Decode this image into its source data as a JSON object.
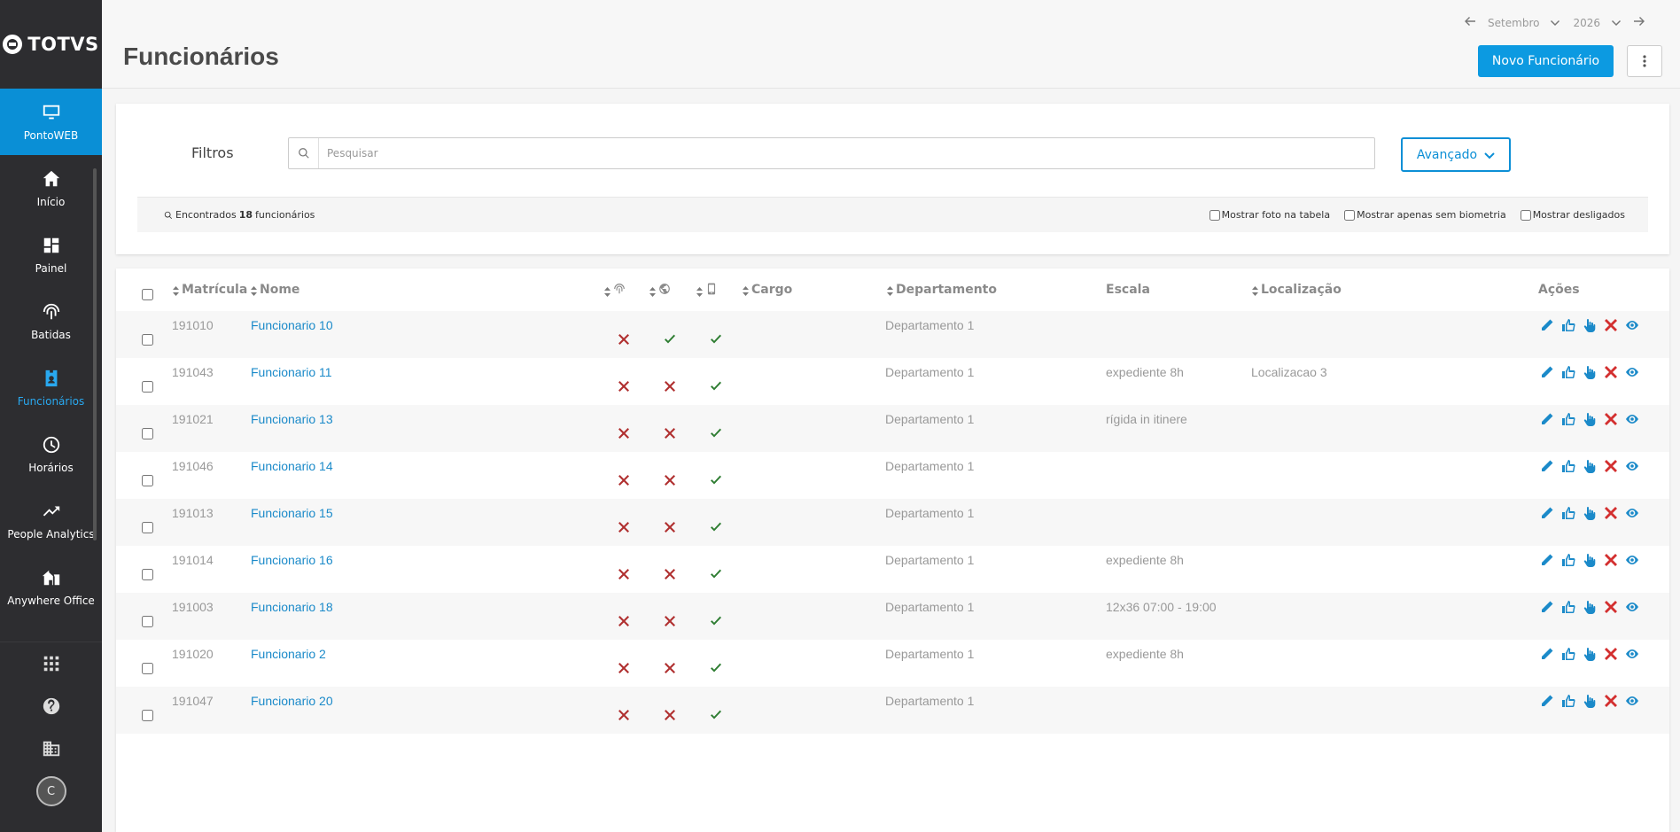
{
  "brand": {
    "name": "TOTVS"
  },
  "sidebar": {
    "product": "PontoWEB",
    "items": [
      {
        "label": "Início",
        "icon": "home-icon"
      },
      {
        "label": "Painel",
        "icon": "dashboard-icon"
      },
      {
        "label": "Batidas",
        "icon": "fingerprint-icon"
      },
      {
        "label": "Funcionários",
        "icon": "badge-icon"
      },
      {
        "label": "Horários",
        "icon": "clock-icon"
      },
      {
        "label": "People Analytics",
        "icon": "trending-icon"
      },
      {
        "label": "Anywhere Office",
        "icon": "home-office-icon"
      }
    ],
    "user_initial": "C"
  },
  "header": {
    "title": "Funcionários",
    "month": "Setembro",
    "year": "2026",
    "new_button": "Novo Funcionário"
  },
  "filters": {
    "label": "Filtros",
    "search_placeholder": "Pesquisar",
    "advanced_button": "Avançado",
    "found_prefix": "Encontrados",
    "found_count": "18",
    "found_suffix": "funcionários",
    "checkboxes": {
      "show_photo": "Mostrar foto na tabela",
      "no_biometry": "Mostrar apenas sem biometria",
      "show_dismissed": "Mostrar desligados"
    }
  },
  "table": {
    "columns": {
      "matricula": "Matrícula",
      "nome": "Nome",
      "cargo": "Cargo",
      "departamento": "Departamento",
      "escala": "Escala",
      "localizacao": "Localização",
      "acoes": "Ações"
    },
    "rows": [
      {
        "matricula": "191010",
        "nome": "Funcionario 10",
        "biometria": false,
        "web": true,
        "mobile": true,
        "cargo": "",
        "departamento": "Departamento 1",
        "escala": "",
        "localizacao": ""
      },
      {
        "matricula": "191043",
        "nome": "Funcionario 11",
        "biometria": false,
        "web": false,
        "mobile": true,
        "cargo": "",
        "departamento": "Departamento 1",
        "escala": "expediente 8h",
        "localizacao": "Localizacao 3"
      },
      {
        "matricula": "191021",
        "nome": "Funcionario 13",
        "biometria": false,
        "web": false,
        "mobile": true,
        "cargo": "",
        "departamento": "Departamento 1",
        "escala": "rígida in itinere",
        "localizacao": ""
      },
      {
        "matricula": "191046",
        "nome": "Funcionario 14",
        "biometria": false,
        "web": false,
        "mobile": true,
        "cargo": "",
        "departamento": "Departamento 1",
        "escala": "",
        "localizacao": ""
      },
      {
        "matricula": "191013",
        "nome": "Funcionario 15",
        "biometria": false,
        "web": false,
        "mobile": true,
        "cargo": "",
        "departamento": "Departamento 1",
        "escala": "",
        "localizacao": ""
      },
      {
        "matricula": "191014",
        "nome": "Funcionario 16",
        "biometria": false,
        "web": false,
        "mobile": true,
        "cargo": "",
        "departamento": "Departamento 1",
        "escala": "expediente 8h",
        "localizacao": ""
      },
      {
        "matricula": "191003",
        "nome": "Funcionario 18",
        "biometria": false,
        "web": false,
        "mobile": true,
        "cargo": "",
        "departamento": "Departamento 1",
        "escala": "12x36 07:00 - 19:00",
        "localizacao": ""
      },
      {
        "matricula": "191020",
        "nome": "Funcionario 2",
        "biometria": false,
        "web": false,
        "mobile": true,
        "cargo": "",
        "departamento": "Departamento 1",
        "escala": "expediente 8h",
        "localizacao": ""
      },
      {
        "matricula": "191047",
        "nome": "Funcionario 20",
        "biometria": false,
        "web": false,
        "mobile": true,
        "cargo": "",
        "departamento": "Departamento 1",
        "escala": "",
        "localizacao": ""
      }
    ]
  },
  "colors": {
    "accent": "#0c9ae1",
    "sidebar_bg": "#2d2d30",
    "check": "#2e7d32",
    "cross": "#c62828",
    "link": "#1b8ac9"
  }
}
